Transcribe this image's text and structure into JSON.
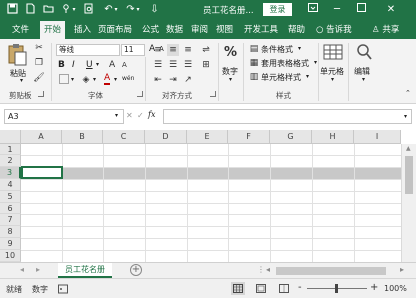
{
  "title_bar": {
    "document_title": "员工花名册...",
    "login_label": "登录",
    "icons": [
      "save-icon",
      "new-file-icon",
      "open-folder-icon",
      "touch-mode-icon",
      "print-preview-icon",
      "undo-icon",
      "redo-icon",
      "customize-icon"
    ]
  },
  "tabs": [
    "文件",
    "开始",
    "插入",
    "页面布局",
    "公式",
    "数据",
    "审阅",
    "视图",
    "开发工具",
    "帮助",
    "告诉我",
    "共享"
  ],
  "ribbon": {
    "clipboard": {
      "paste_label": "粘贴",
      "group_label": "剪贴板"
    },
    "font": {
      "font_name": "等线",
      "font_size": "11",
      "bold": "B",
      "italic": "I",
      "underline": "U",
      "grow": "A",
      "shrink": "A",
      "color_a": "A",
      "phonetic": "wén",
      "group_label": "字体"
    },
    "alignment": {
      "group_label": "对齐方式"
    },
    "number": {
      "label": "数字",
      "percent": "%"
    },
    "styles": {
      "conditional": "条件格式",
      "table": "套用表格格式",
      "cell_style": "单元格样式",
      "group_label": "样式"
    },
    "cells": {
      "label": "单元格"
    },
    "editing": {
      "label": "编辑"
    }
  },
  "formula_bar": {
    "name_box": "A3",
    "fx": "fx",
    "value": ""
  },
  "grid": {
    "columns": [
      "A",
      "B",
      "C",
      "D",
      "E",
      "F",
      "G",
      "H",
      "I"
    ],
    "rows": [
      "1",
      "2",
      "3",
      "4",
      "5",
      "6",
      "7",
      "8",
      "9",
      "10"
    ],
    "selected_row": "3"
  },
  "sheet_tabs": {
    "active": "员工花名册",
    "add": "+"
  },
  "status_bar": {
    "ready": "就绪",
    "mode": "数字",
    "zoom": "100%",
    "zoom_minus": "-",
    "zoom_plus": "+"
  },
  "colors": {
    "accent": "#217346",
    "ribbon_bg": "#f3f3f3",
    "header_bg": "#e6e6e6"
  }
}
